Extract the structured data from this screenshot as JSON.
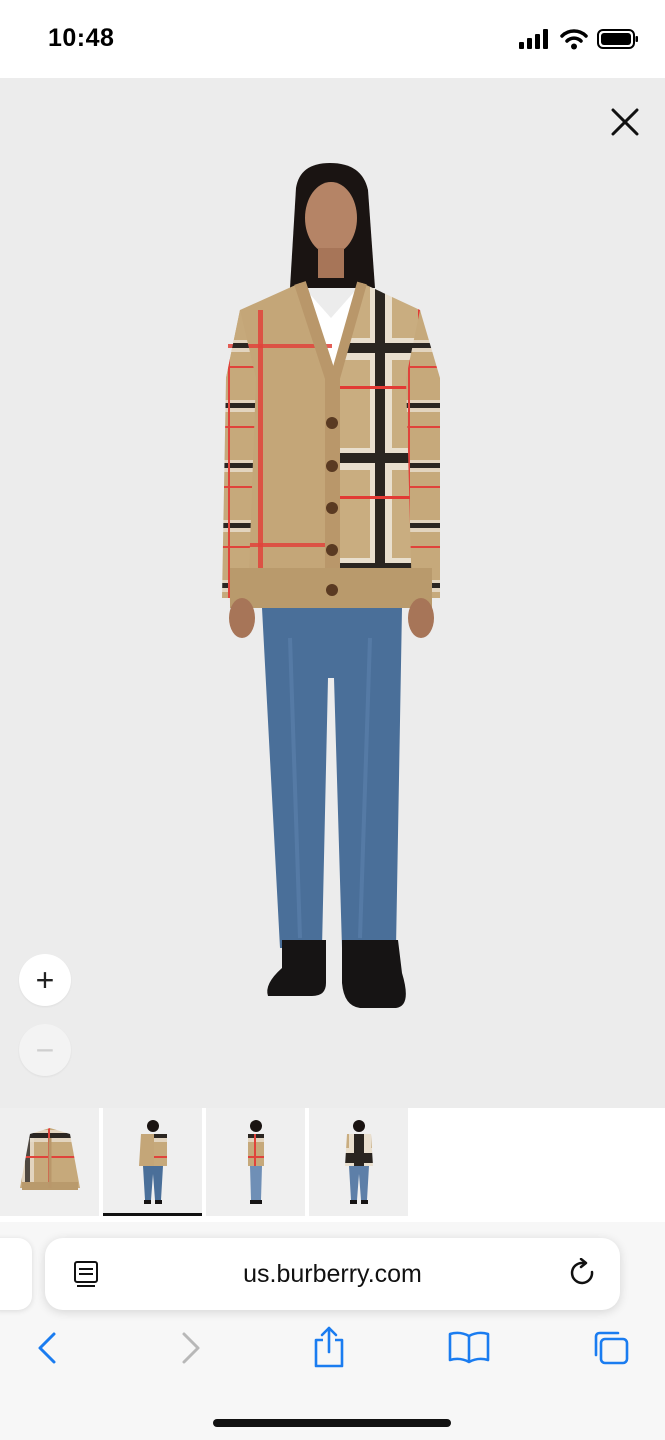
{
  "status_bar": {
    "time": "10:48"
  },
  "viewer": {
    "close_icon": "close-icon",
    "zoom_in_label": "+",
    "zoom_out_label": "−"
  },
  "thumbnails": [
    {
      "name": "thumb-cardigan-flat",
      "active": false
    },
    {
      "name": "thumb-model-front",
      "active": true
    },
    {
      "name": "thumb-model-side",
      "active": false
    },
    {
      "name": "thumb-model-back",
      "active": false
    }
  ],
  "browser": {
    "url": "us.burberry.com",
    "icons": [
      "reader-icon",
      "reload-icon",
      "back-icon",
      "forward-icon",
      "share-icon",
      "bookmarks-icon",
      "tabs-icon"
    ]
  },
  "colors": {
    "accent": "#1a7cf0",
    "viewer_bg": "#ececec",
    "camel": "#c6a97b",
    "denim": "#4a6f99"
  }
}
